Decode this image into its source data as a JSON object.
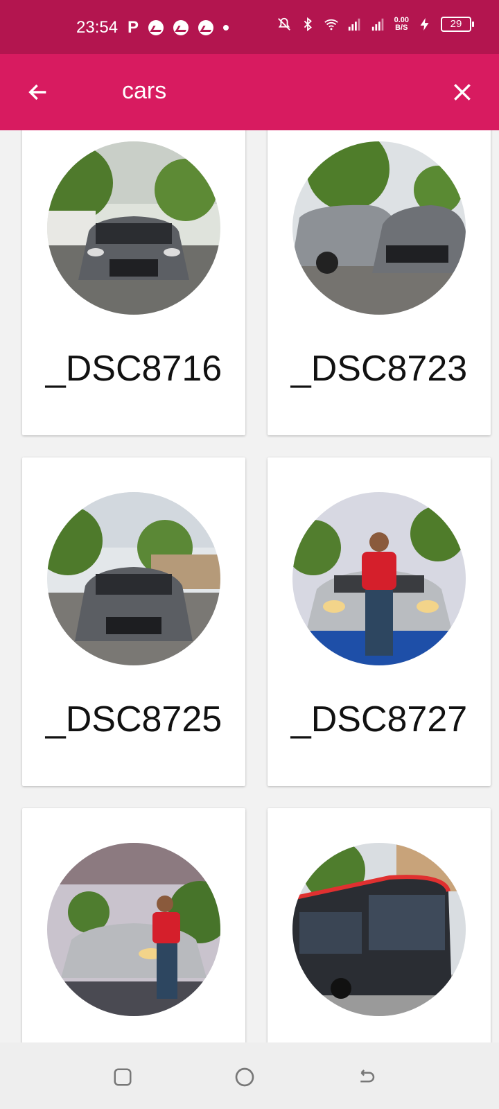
{
  "status_bar": {
    "time": "23:54",
    "net_speed_value": "0.00",
    "net_speed_unit": "B/S",
    "battery": "29",
    "icons": [
      "parking-icon",
      "messenger-icon",
      "messenger-icon",
      "messenger-icon",
      "dot-icon",
      "mute-icon",
      "bluetooth-icon",
      "wifi-icon",
      "signal-icon",
      "signal-icon",
      "charging-icon"
    ]
  },
  "app_bar": {
    "search_value": "cars",
    "back_icon": "arrow-left-icon",
    "close_icon": "close-icon",
    "color": "#d81b60"
  },
  "items": [
    {
      "title": "_DSC8716"
    },
    {
      "title": "_DSC8723"
    },
    {
      "title": "_DSC8725"
    },
    {
      "title": "_DSC8727"
    },
    {
      "title": ""
    },
    {
      "title": ""
    }
  ],
  "nav_bar": {
    "icons": [
      "recents-icon",
      "home-icon",
      "back-icon"
    ]
  },
  "colors": {
    "status_bar": "#b3154f",
    "app_bar": "#d81b60",
    "background": "#f2f2f2"
  }
}
